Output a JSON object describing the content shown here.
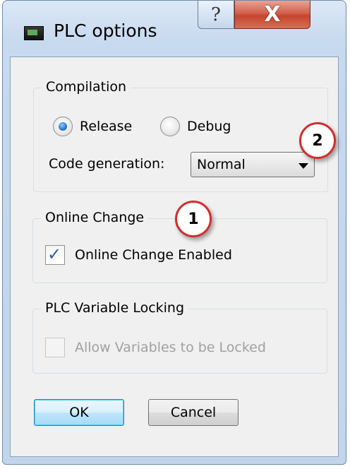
{
  "window": {
    "title": "PLC options",
    "help_glyph": "?",
    "close_glyph": "X"
  },
  "compilation": {
    "label": "Compilation",
    "release_label": "Release",
    "debug_label": "Debug",
    "selected": "Release",
    "code_generation_label": "Code generation:",
    "code_generation_value": "Normal"
  },
  "online_change": {
    "label": "Online Change",
    "checkbox_label": "Online Change Enabled",
    "checked": true
  },
  "locking": {
    "label": "PLC Variable Locking",
    "checkbox_label": "Allow Variables to be Locked",
    "enabled": false,
    "checked": false
  },
  "buttons": {
    "ok": "OK",
    "cancel": "Cancel"
  },
  "callouts": {
    "one": "1",
    "two": "2",
    "color": "#d22c2c"
  },
  "icons": {
    "app": "plc-window-icon",
    "help": "question-mark-icon",
    "close": "close-x-icon",
    "check": "check-icon",
    "dropdown": "chevron-down-icon"
  }
}
